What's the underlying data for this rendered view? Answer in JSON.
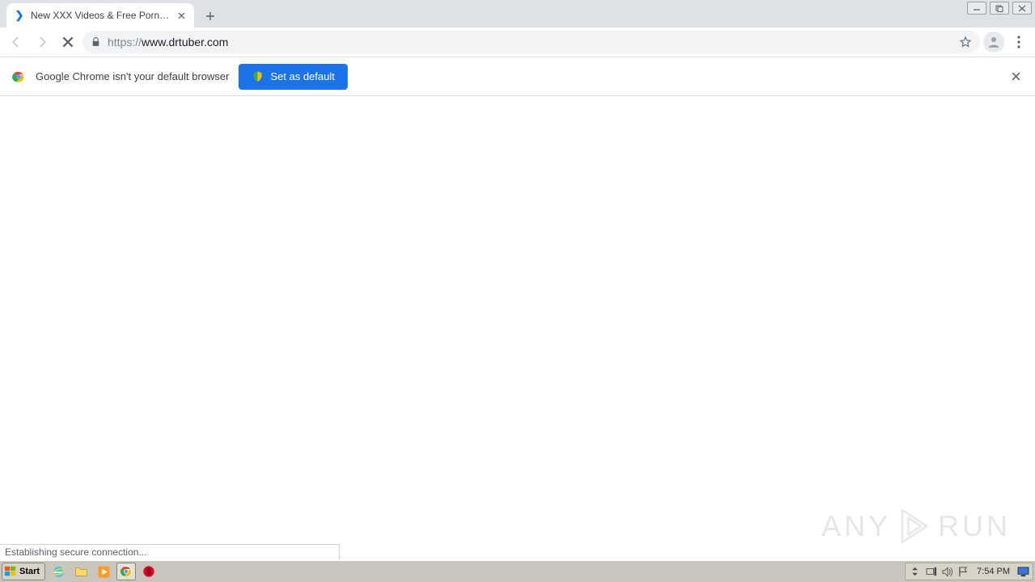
{
  "window_controls": {
    "min": "–",
    "max": "❐",
    "close": "✕"
  },
  "tab": {
    "title": "New XXX Videos & Free Porn Movies",
    "favicon_glyph": "❯"
  },
  "newtab_symbol": "+",
  "omnibox": {
    "scheme": "https://",
    "host": "www.drtuber.com"
  },
  "infobar": {
    "message": "Google Chrome isn't your default browser",
    "button": "Set as default"
  },
  "status": "Establishing secure connection...",
  "watermark": {
    "left": "ANY",
    "right": "RUN"
  },
  "taskbar": {
    "start": "Start",
    "clock": "7:54 PM"
  }
}
